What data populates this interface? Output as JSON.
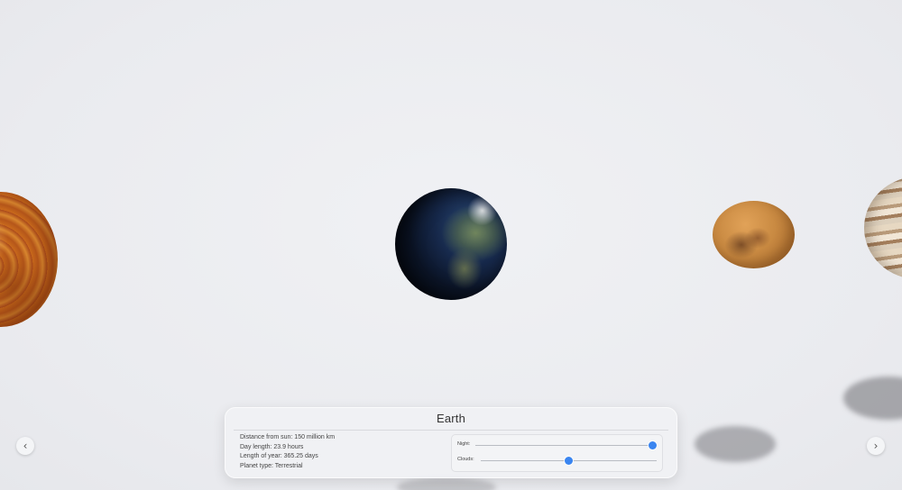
{
  "planets": [
    {
      "name": "venus",
      "icon": "venus-planet"
    },
    {
      "name": "earth",
      "icon": "earth-planet"
    },
    {
      "name": "mars",
      "icon": "mars-planet"
    },
    {
      "name": "jupiter",
      "icon": "jupiter-planet"
    }
  ],
  "nav": {
    "prev_icon": "chevron-left-icon",
    "next_icon": "chevron-right-icon",
    "prev_glyph": "‹",
    "next_glyph": "›"
  },
  "info": {
    "title": "Earth",
    "facts": [
      "Distance from sun: 150 million km",
      "Day length: 23.9 hours",
      "Length of year: 365.25 days",
      "Planet type: Terrestrial"
    ]
  },
  "sliders": [
    {
      "label": "Night:",
      "value": 1.0
    },
    {
      "label": "Clouds:",
      "value": 0.5
    }
  ],
  "colors": {
    "accent": "#3a85f0",
    "background": "#ecedf1"
  }
}
